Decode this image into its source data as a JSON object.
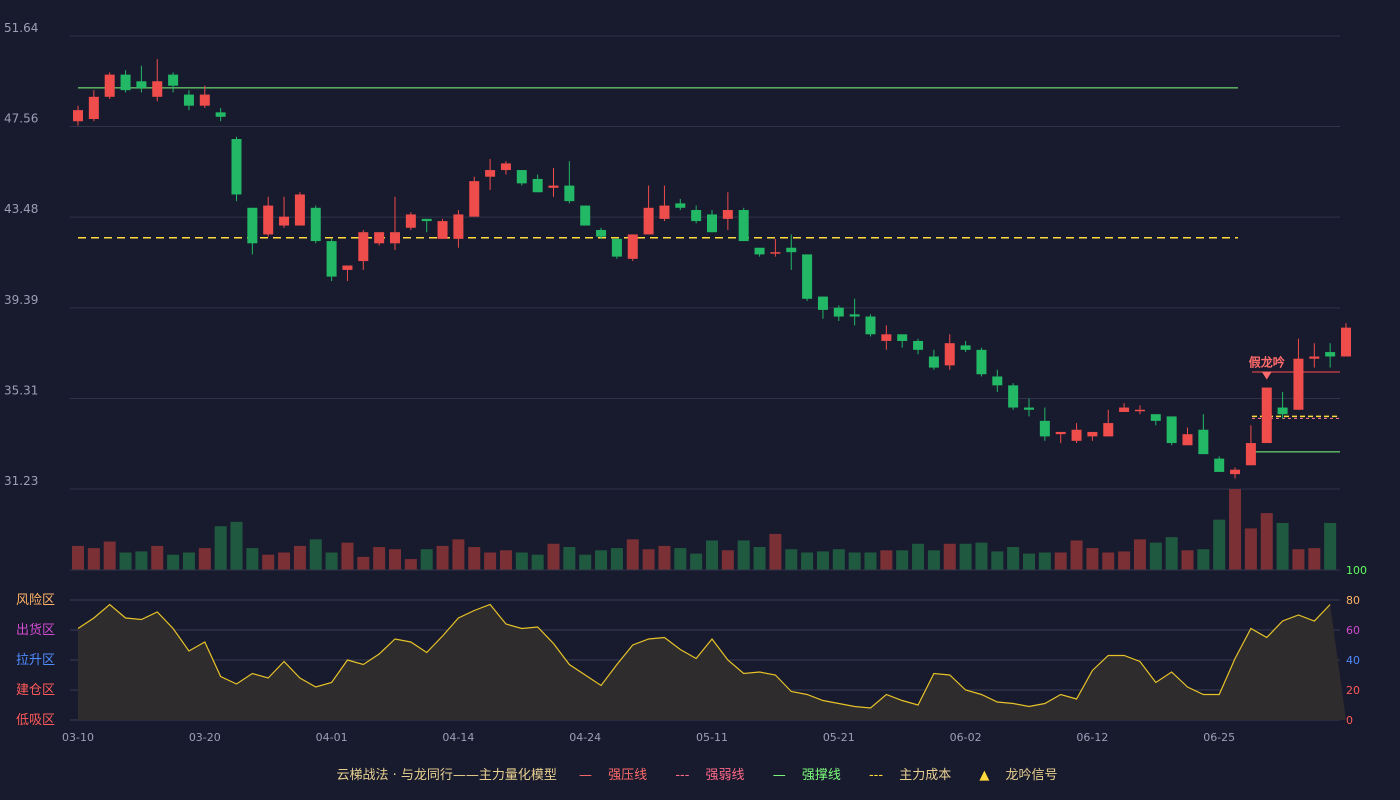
{
  "legend": {
    "title": "云梯战法 · 与龙同行——主力量化模型",
    "items": [
      {
        "label": "强压线",
        "glyph": "—",
        "color": "#ff4d4f"
      },
      {
        "label": "强弱线",
        "glyph": "---",
        "color": "#ff7aa0"
      },
      {
        "label": "强撑线",
        "glyph": "—",
        "color": "#7dff7d"
      },
      {
        "label": "主力成本",
        "glyph": "---",
        "color": "#ffd93d"
      },
      {
        "label": "龙吟信号",
        "glyph": "▲",
        "color": "#ffd93d"
      }
    ]
  },
  "signal_label": "假龙吟",
  "chart_data": {
    "type": "candlestick",
    "price_axis": {
      "ticks": [
        "51.64",
        "47.56",
        "43.48",
        "39.39",
        "35.31",
        "31.23"
      ],
      "ylim": [
        31.23,
        51.64
      ]
    },
    "date_ticks": [
      "03-10",
      "03-20",
      "04-01",
      "04-14",
      "04-24",
      "05-11",
      "05-21",
      "06-02",
      "06-12",
      "06-25"
    ],
    "candles": [
      [
        47.8,
        48.3,
        47.6,
        48.5
      ],
      [
        47.9,
        48.9,
        47.8,
        49.2
      ],
      [
        48.9,
        49.9,
        48.8,
        50.0
      ],
      [
        49.9,
        49.2,
        49.1,
        50.1
      ],
      [
        49.6,
        49.3,
        49.1,
        50.3
      ],
      [
        48.9,
        49.6,
        48.7,
        50.6
      ],
      [
        49.9,
        49.4,
        49.1,
        50.0
      ],
      [
        49.0,
        48.5,
        48.3,
        49.2
      ],
      [
        48.5,
        49.0,
        48.4,
        49.4
      ],
      [
        48.2,
        48.0,
        47.8,
        48.4
      ],
      [
        47.0,
        44.5,
        44.2,
        47.1
      ],
      [
        43.9,
        42.3,
        41.8,
        43.9
      ],
      [
        42.7,
        44.0,
        42.6,
        44.4
      ],
      [
        43.1,
        43.5,
        43.0,
        44.4
      ],
      [
        43.1,
        44.5,
        43.1,
        44.6
      ],
      [
        43.9,
        42.4,
        42.3,
        44.0
      ],
      [
        42.4,
        40.8,
        40.6,
        42.5
      ],
      [
        41.1,
        41.3,
        40.6,
        41.3
      ],
      [
        41.5,
        42.8,
        41.1,
        42.9
      ],
      [
        42.3,
        42.8,
        42.2,
        42.8
      ],
      [
        42.3,
        42.8,
        42.0,
        44.4
      ],
      [
        43.0,
        43.6,
        42.9,
        43.7
      ],
      [
        43.4,
        43.3,
        42.8,
        43.4
      ],
      [
        42.5,
        43.3,
        42.5,
        43.4
      ],
      [
        42.5,
        43.6,
        42.1,
        43.8
      ],
      [
        43.5,
        45.1,
        43.5,
        45.3
      ],
      [
        45.3,
        45.6,
        44.7,
        46.1
      ],
      [
        45.6,
        45.9,
        45.4,
        46.0
      ],
      [
        45.6,
        45.0,
        44.9,
        45.6
      ],
      [
        45.2,
        44.6,
        44.6,
        45.4
      ],
      [
        44.8,
        44.9,
        44.4,
        45.7
      ],
      [
        44.9,
        44.2,
        44.1,
        46.0
      ],
      [
        44.0,
        43.1,
        43.1,
        44.0
      ],
      [
        42.9,
        42.6,
        42.5,
        43.0
      ],
      [
        42.5,
        41.7,
        41.6,
        42.5
      ],
      [
        41.6,
        42.7,
        41.5,
        42.7
      ],
      [
        42.7,
        43.9,
        42.7,
        44.9
      ],
      [
        43.4,
        44.0,
        43.3,
        44.9
      ],
      [
        44.1,
        43.9,
        43.8,
        44.3
      ],
      [
        43.8,
        43.3,
        43.2,
        44.0
      ],
      [
        43.6,
        42.8,
        42.8,
        43.8
      ],
      [
        43.4,
        43.8,
        42.9,
        44.6
      ],
      [
        43.8,
        42.4,
        42.4,
        43.9
      ],
      [
        42.1,
        41.8,
        41.7,
        42.1
      ],
      [
        41.9,
        41.9,
        41.7,
        42.5
      ],
      [
        42.1,
        41.9,
        41.1,
        42.7
      ],
      [
        41.8,
        39.8,
        39.7,
        41.8
      ],
      [
        39.9,
        39.3,
        38.9,
        39.9
      ],
      [
        39.4,
        39.0,
        38.8,
        39.5
      ],
      [
        39.1,
        39.0,
        38.6,
        39.8
      ],
      [
        39.0,
        38.2,
        38.1,
        39.1
      ],
      [
        37.9,
        38.2,
        37.5,
        38.6
      ],
      [
        38.2,
        37.9,
        37.6,
        38.2
      ],
      [
        37.9,
        37.5,
        37.3,
        38.0
      ],
      [
        37.2,
        36.7,
        36.6,
        37.5
      ],
      [
        36.8,
        37.8,
        36.6,
        38.2
      ],
      [
        37.7,
        37.5,
        37.4,
        37.9
      ],
      [
        37.5,
        36.4,
        36.3,
        37.6
      ],
      [
        36.3,
        35.9,
        35.6,
        36.6
      ],
      [
        35.9,
        34.9,
        34.8,
        36.0
      ],
      [
        34.9,
        34.8,
        34.5,
        35.3
      ],
      [
        34.3,
        33.6,
        33.4,
        34.9
      ],
      [
        33.7,
        33.8,
        33.3,
        33.8
      ],
      [
        33.4,
        33.9,
        33.3,
        34.2
      ],
      [
        33.6,
        33.8,
        33.4,
        33.8
      ],
      [
        33.6,
        34.2,
        33.6,
        34.8
      ],
      [
        34.7,
        34.9,
        34.7,
        35.1
      ],
      [
        34.8,
        34.8,
        34.6,
        35.0
      ],
      [
        34.6,
        34.3,
        34.1,
        34.6
      ],
      [
        34.5,
        33.3,
        33.2,
        34.5
      ],
      [
        33.2,
        33.7,
        33.3,
        34.0
      ],
      [
        33.9,
        32.8,
        32.8,
        34.6
      ],
      [
        32.6,
        32.0,
        32.0,
        32.7
      ],
      [
        31.9,
        32.1,
        31.7,
        32.2
      ],
      [
        32.3,
        33.3,
        32.7,
        34.1
      ],
      [
        33.3,
        35.8,
        33.6,
        35.8
      ],
      [
        34.9,
        34.6,
        34.4,
        35.6
      ],
      [
        34.8,
        37.1,
        34.8,
        38.0
      ],
      [
        37.1,
        37.2,
        36.7,
        37.8
      ],
      [
        37.4,
        37.2,
        36.7,
        37.8
      ],
      [
        37.2,
        38.5,
        37.2,
        38.7
      ]
    ],
    "volume": [
      22,
      20,
      26,
      16,
      17,
      22,
      14,
      16,
      20,
      40,
      44,
      20,
      14,
      16,
      22,
      28,
      16,
      25,
      12,
      21,
      19,
      10,
      19,
      22,
      28,
      21,
      16,
      18,
      16,
      14,
      24,
      21,
      14,
      18,
      20,
      28,
      19,
      22,
      20,
      15,
      27,
      18,
      27,
      21,
      33,
      19,
      16,
      17,
      19,
      16,
      16,
      18,
      18,
      24,
      18,
      24,
      24,
      25,
      17,
      21,
      15,
      16,
      16,
      27,
      20,
      16,
      17,
      28,
      25,
      30,
      18,
      19,
      46,
      74,
      38,
      52,
      43,
      19,
      20,
      43
    ],
    "volume_colors": "same as candle direction",
    "oscillator": {
      "values": [
        61,
        68,
        77,
        68,
        67,
        72,
        61,
        46,
        52,
        29,
        24,
        31,
        28,
        39,
        28,
        22,
        25,
        40,
        37,
        44,
        54,
        52,
        45,
        56,
        68,
        73,
        77,
        64,
        61,
        62,
        51,
        37,
        30,
        23,
        37,
        50,
        54,
        55,
        47,
        41,
        54,
        40,
        31,
        32,
        30,
        19,
        17,
        13,
        11,
        9,
        8,
        17,
        13,
        10,
        31,
        30,
        20,
        17,
        12,
        11,
        9,
        11,
        17,
        14,
        33,
        43,
        43,
        39,
        25,
        32,
        22,
        17,
        17,
        41,
        61,
        55,
        66,
        70,
        66,
        77
      ],
      "zones": [
        "风险区",
        "出货区",
        "拉升区",
        "建仓区",
        "低吸区"
      ],
      "zone_colors": [
        "#ffb366",
        "#d04bd0",
        "#4f8cff",
        "#ff5a5a",
        "#ff5a5a"
      ],
      "axis_ticks": [
        "100",
        "80",
        "60",
        "40",
        "20",
        "0"
      ],
      "axis_tick_colors": [
        "#5cff5c",
        "#ffb366",
        "#d04bd0",
        "#4f8cff",
        "#ff5a5a",
        "#ff5a5a"
      ]
    },
    "lines": {
      "strong_support_level": 49.3,
      "main_cost_level": 42.55,
      "right_resist_level": 36.5,
      "right_cost_level": 34.5,
      "right_support_level": 32.9
    }
  }
}
